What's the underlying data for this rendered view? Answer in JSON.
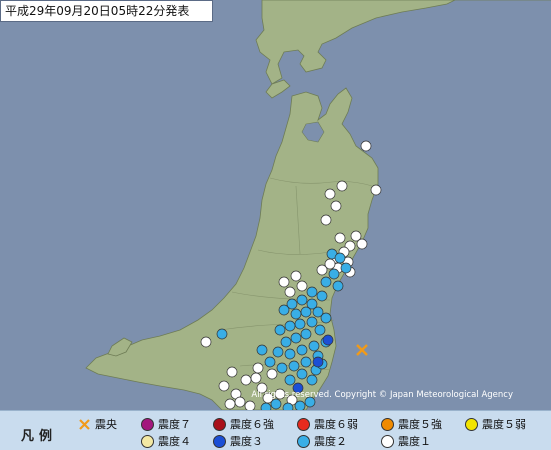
{
  "title": "平成29年09月20日05時22分発表",
  "copyright": "All rights reserved. Copyright © Japan Meteorological Agency",
  "colors": {
    "sea": "#7d90ad",
    "land": "#a3b387",
    "land_border": "#6e7c55",
    "epicenter": "#f09a1a",
    "intensity_1": "#ffffff",
    "intensity_2": "#39aee6",
    "intensity_3": "#1b4fd6",
    "intensity_4": "#f3e9a4",
    "intensity_5_lower": "#f2e400",
    "intensity_5_upper": "#f08a00",
    "intensity_6_lower": "#e62b1e",
    "intensity_6_upper": "#a8101a",
    "intensity_7": "#a3187d"
  },
  "legend": {
    "title": "凡例",
    "items": [
      {
        "key": "epicenter",
        "label": "震央",
        "symbol": "x-mark-icon"
      },
      {
        "key": "intensity_7",
        "label": "震度７"
      },
      {
        "key": "intensity_6_upper",
        "label": "震度６強"
      },
      {
        "key": "intensity_6_lower",
        "label": "震度６弱"
      },
      {
        "key": "intensity_5_upper",
        "label": "震度５強"
      },
      {
        "key": "intensity_5_lower",
        "label": "震度５弱"
      },
      {
        "key": "intensity_4",
        "label": "震度４"
      },
      {
        "key": "intensity_3",
        "label": "震度３"
      },
      {
        "key": "intensity_2",
        "label": "震度２"
      },
      {
        "key": "intensity_1",
        "label": "震度１"
      }
    ]
  }
}
